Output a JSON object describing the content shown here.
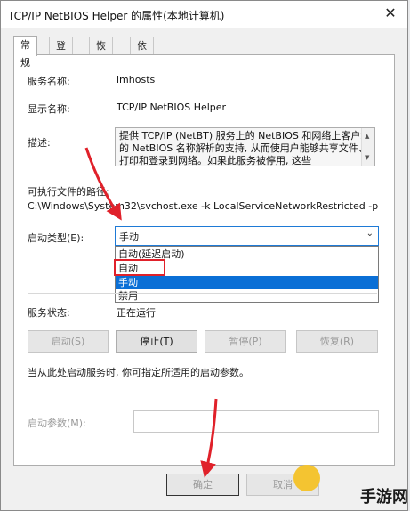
{
  "window": {
    "title": "TCP/IP NetBIOS Helper 的属性(本地计算机)"
  },
  "tabs": [
    {
      "label": "常规"
    },
    {
      "label": "登录"
    },
    {
      "label": "恢复"
    },
    {
      "label": "依存关系"
    }
  ],
  "general": {
    "service_name_label": "服务名称:",
    "service_name": "lmhosts",
    "display_name_label": "显示名称:",
    "display_name": "TCP/IP NetBIOS Helper",
    "description_label": "描述:",
    "description": "提供 TCP/IP (NetBT) 服务上的 NetBIOS 和网络上客户端的 NetBIOS 名称解析的支持, 从而使用户能够共享文件、打印和登录到网络。如果此服务被停用, 这些",
    "exe_path_label": "可执行文件的路径:",
    "exe_path": "C:\\Windows\\System32\\svchost.exe -k LocalServiceNetworkRestricted -p",
    "startup_type_label": "启动类型(E):",
    "startup_type_value": "手动",
    "startup_options": [
      "自动(延迟启动)",
      "自动",
      "手动",
      "禁用"
    ],
    "status_label": "服务状态:",
    "status_value": "正在运行",
    "hint": "当从此处启动服务时, 你可指定所适用的启动参数。",
    "start_params_label": "启动参数(M):"
  },
  "service_buttons": {
    "start": "启动(S)",
    "stop": "停止(T)",
    "pause": "暂停(P)",
    "resume": "恢复(R)"
  },
  "dialog_buttons": {
    "ok": "确定",
    "cancel": "取消"
  },
  "watermark": "手游网",
  "colors": {
    "highlight": "#0a6fd6",
    "annotation": "#e0212a"
  }
}
